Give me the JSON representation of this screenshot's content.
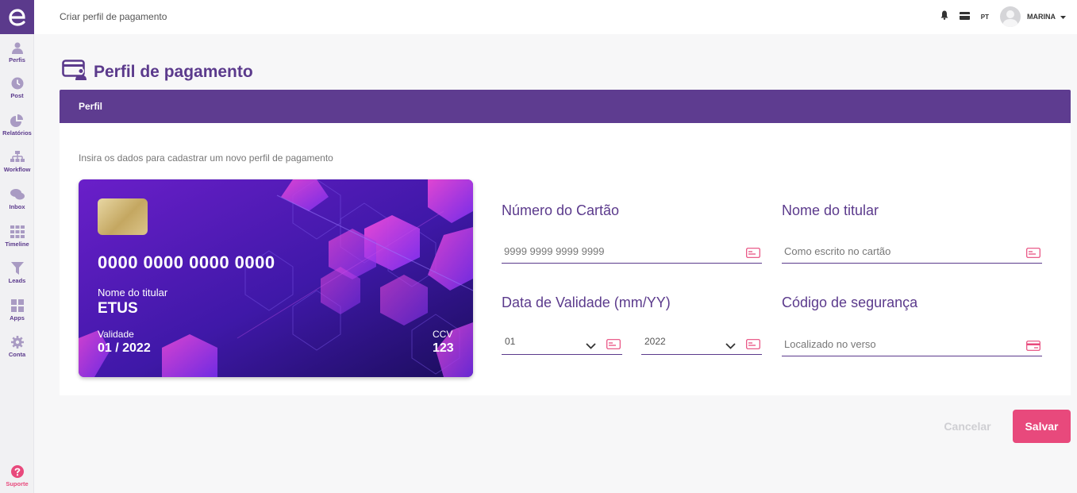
{
  "sidebar": {
    "items": [
      {
        "label": "Perfis",
        "icon": "user-icon"
      },
      {
        "label": "Post",
        "icon": "clock-icon"
      },
      {
        "label": "Relatórios",
        "icon": "pie-chart-icon"
      },
      {
        "label": "Workflow",
        "icon": "sitemap-icon"
      },
      {
        "label": "Inbox",
        "icon": "chat-icon"
      },
      {
        "label": "Timeline",
        "icon": "grid-icon"
      },
      {
        "label": "Leads",
        "icon": "filter-icon"
      },
      {
        "label": "Apps",
        "icon": "apps-icon"
      },
      {
        "label": "Conta",
        "icon": "gear-icon"
      }
    ],
    "support_label": "Suporte"
  },
  "topbar": {
    "breadcrumb": "Criar perfil de pagamento",
    "language": "PT",
    "user_name": "MARINA"
  },
  "page": {
    "title": "Perfil de pagamento"
  },
  "panel": {
    "header": "Perfil",
    "instruction": "Insira os dados para cadastrar um novo perfil de pagamento"
  },
  "card": {
    "number": "0000 0000 0000 0000",
    "holder_label": "Nome do titular",
    "holder": "ETUS",
    "validity_label": "Validade",
    "validity": "01 / 2022",
    "ccv_label": "CCV",
    "ccv": "123"
  },
  "form": {
    "card_number": {
      "label": "Número do Cartão",
      "placeholder": "9999 9999 9999 9999",
      "value": ""
    },
    "holder_name": {
      "label": "Nome do titular",
      "placeholder": "Como escrito no cartão",
      "value": ""
    },
    "expiry": {
      "label": "Data de Validade (mm/YY)",
      "month": "01",
      "year": "2022"
    },
    "security_code": {
      "label": "Código de segurança",
      "placeholder": "Localizado no verso",
      "value": ""
    }
  },
  "actions": {
    "cancel": "Cancelar",
    "save": "Salvar"
  },
  "colors": {
    "brand": "#5b3a8c",
    "accent": "#e8497c",
    "sidebar_bg": "#f1f1f3",
    "panel_header": "#5e3c90"
  }
}
